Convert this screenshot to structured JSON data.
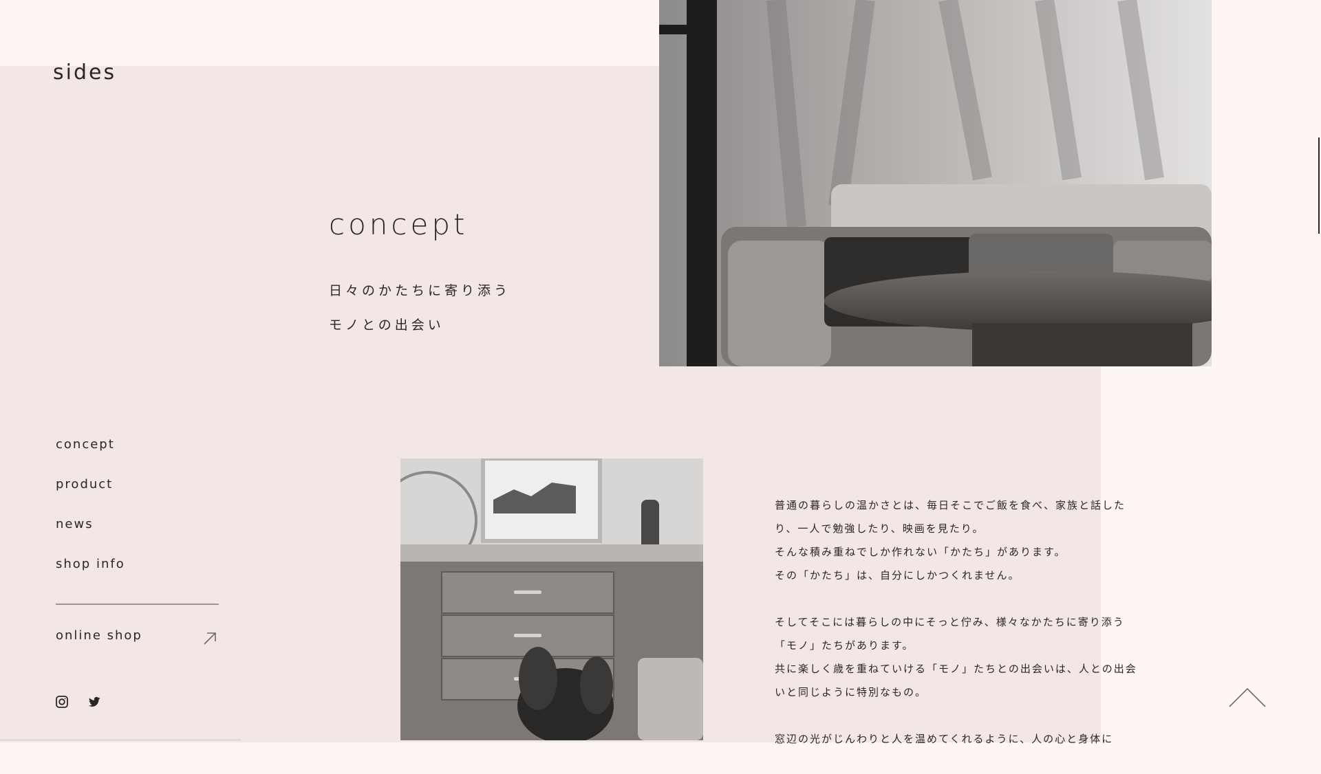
{
  "brand": {
    "logo_text": "sides"
  },
  "hero": {
    "title": "concept",
    "subtitle_line1": "日々のかたちに寄り添う",
    "subtitle_line2": "モノとの出会い",
    "image_icon": "living-room-photo"
  },
  "nav": {
    "items": [
      {
        "label": "concept"
      },
      {
        "label": "product"
      },
      {
        "label": "news"
      },
      {
        "label": "shop info"
      }
    ],
    "online_shop_label": "online shop",
    "online_shop_icon": "external-arrow-icon"
  },
  "social": {
    "icons": [
      "instagram-icon",
      "twitter-icon"
    ]
  },
  "content": {
    "paragraph1_line1": "普通の暮らしの温かさとは、毎日そこでご飯を食べ、家族と話したり、一人で勉強したり、映画を見たり。",
    "paragraph1_line2": "そんな積み重ねでしか作れない「かたち」があります。",
    "paragraph1_line3": "その「かたち」は、自分にしかつくれません。",
    "paragraph2_line1": "そしてそこには暮らしの中にそっと佇み、様々なかたちに寄り添う「モノ」たちがあります。",
    "paragraph2_line2": "共に楽しく歳を重ねていける「モノ」たちとの出会いは、人との出会いと同じように特別なもの。",
    "paragraph3_line1": "窓辺の光がじんわりと人を温めてくれるように、人の心と身体に",
    "image_icon": "sideboard-photo"
  },
  "colors": {
    "page_bg": "#fdf6f4",
    "panel_bg": "#f2e7e5",
    "text": "#2b2626"
  },
  "scroll_top_icon": "chevron-up-icon"
}
